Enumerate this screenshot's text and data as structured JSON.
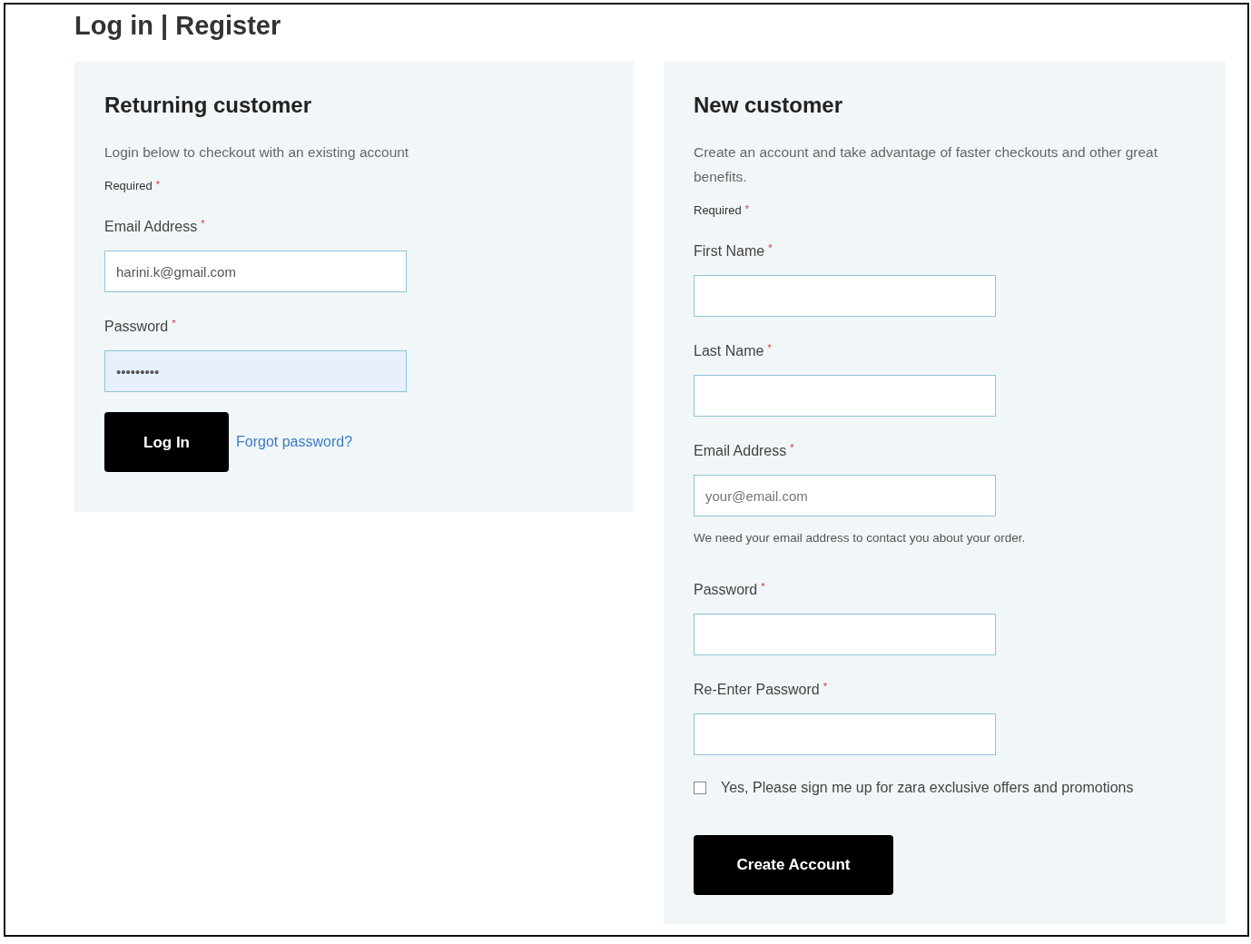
{
  "page_title": "Log in | Register",
  "returning": {
    "title": "Returning customer",
    "intro": "Login below to checkout with an existing account",
    "required_note": {
      "label": "Required",
      "mark": "*"
    },
    "fields": [
      {
        "label": "Email Address",
        "mark": "*",
        "value": "harini.k@gmail.com",
        "autofilled": false
      },
      {
        "label": "Password",
        "mark": "*",
        "value": "•••••••••",
        "autofilled": true
      }
    ],
    "button": "Log In",
    "link": "Forgot password?"
  },
  "new": {
    "title": "New customer",
    "intro": "Create an account and take advantage of faster checkouts and other great benefits.",
    "required_note": {
      "label": "Required",
      "mark": "*"
    },
    "fields": [
      {
        "label": "First Name",
        "mark": "*"
      },
      {
        "label": "Last Name",
        "mark": "*"
      },
      {
        "label": "Email Address",
        "mark": "*",
        "placeholder": "your@email.com",
        "help": "We need your email address to contact you about your order."
      },
      {
        "label": "Password",
        "mark": "*"
      },
      {
        "label": "Re-Enter Password",
        "mark": "*"
      }
    ],
    "checkbox": {
      "label": "Yes, Please sign me up for zara exclusive offers and promotions",
      "checked": false
    },
    "button": "Create Account"
  }
}
